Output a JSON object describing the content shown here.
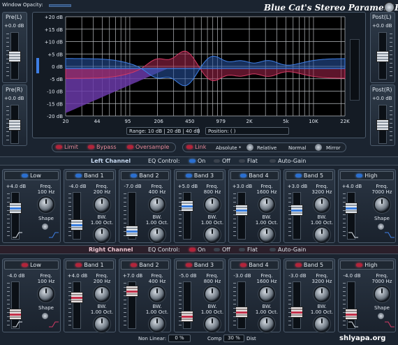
{
  "window_opacity_label": "Window Opacity:",
  "title": "Blue Cat's Stereo Parametr'EQ",
  "meters": {
    "pre_l": {
      "label": "Pre(L)",
      "value": "+0.0 dB"
    },
    "pre_r": {
      "label": "Pre(R)",
      "value": "+0.0 dB"
    },
    "post_l": {
      "label": "Post(L)",
      "value": "+0.0 dB"
    },
    "post_r": {
      "label": "Post(R)",
      "value": "+0.0 dB"
    }
  },
  "graph": {
    "db_labels": [
      "+20 dB",
      "+15 dB",
      "+10 dB",
      "+5 dB",
      "0 dB",
      "-5 dB",
      "-10 dB",
      "-15 dB",
      "-20 dB"
    ],
    "freq_labels": [
      "20",
      "44",
      "95",
      "206",
      "450",
      "979",
      "2K",
      "5k",
      "10K",
      "22K"
    ],
    "range_text": "Range:  10 dB  |  20 dB  |  40 dB",
    "position_text": "Position: (                    )"
  },
  "options": {
    "limit": "Limit",
    "bypass": "Bypass",
    "oversample": "Oversample",
    "link": "Link",
    "absolute": "Absolute *",
    "relative": "Relative",
    "normal": "Normal",
    "mirror": "Mirror"
  },
  "left": {
    "title": "Left Channel",
    "eq_control": "EQ Control:",
    "on": "On",
    "off": "Off",
    "flat": "Flat",
    "auto_gain": "Auto-Gain",
    "bands": [
      {
        "name": "Low",
        "gain": "+4.0 dB",
        "freq_label": "Freq.",
        "freq": "100 Hz",
        "shape_label": "Shape"
      },
      {
        "name": "Band 1",
        "gain": "-4.0 dB",
        "freq_label": "Freq.",
        "freq": "200 Hz",
        "bw_label": "BW.",
        "bw": "1.00 Oct."
      },
      {
        "name": "Band 2",
        "gain": "-7.0 dB",
        "freq_label": "Freq.",
        "freq": "400 Hz",
        "bw_label": "BW.",
        "bw": "1.00 Oct."
      },
      {
        "name": "Band 3",
        "gain": "+5.0 dB",
        "freq_label": "Freq.",
        "freq": "800 Hz",
        "bw_label": "BW.",
        "bw": "1.00 Oct."
      },
      {
        "name": "Band 4",
        "gain": "+3.0 dB",
        "freq_label": "Freq.",
        "freq": "1600 Hz",
        "bw_label": "BW.",
        "bw": "1.00 Oct."
      },
      {
        "name": "Band 5",
        "gain": "+3.0 dB",
        "freq_label": "Freq.",
        "freq": "3200 Hz",
        "bw_label": "BW.",
        "bw": "1.00 Oct."
      },
      {
        "name": "High",
        "gain": "+4.0 dB",
        "freq_label": "Freq.",
        "freq": "7000 Hz",
        "shape_label": "Shape"
      }
    ]
  },
  "right": {
    "title": "Right Channel",
    "eq_control": "EQ Control:",
    "on": "On",
    "off": "Off",
    "flat": "Flat",
    "auto_gain": "Auto-Gain",
    "bands": [
      {
        "name": "Low",
        "gain": "-4.0 dB",
        "freq_label": "Freq.",
        "freq": "100 Hz",
        "shape_label": "Shape"
      },
      {
        "name": "Band 1",
        "gain": "+4.0 dB",
        "freq_label": "Freq.",
        "freq": "200 Hz",
        "bw_label": "BW.",
        "bw": "1.00 Oct."
      },
      {
        "name": "Band 2",
        "gain": "+7.0 dB",
        "freq_label": "Freq.",
        "freq": "400 Hz",
        "bw_label": "BW.",
        "bw": "1.00 Oct."
      },
      {
        "name": "Band 3",
        "gain": "-5.0 dB",
        "freq_label": "Freq.",
        "freq": "800 Hz",
        "bw_label": "BW.",
        "bw": "1.00 Oct."
      },
      {
        "name": "Band 4",
        "gain": "-3.0 dB",
        "freq_label": "Freq.",
        "freq": "1600 Hz",
        "bw_label": "BW.",
        "bw": "1.00 Oct."
      },
      {
        "name": "Band 5",
        "gain": "-3.0 dB",
        "freq_label": "Freq.",
        "freq": "3200 Hz",
        "bw_label": "BW.",
        "bw": "1.00 Oct."
      },
      {
        "name": "High",
        "gain": "-4.0 dB",
        "freq_label": "Freq.",
        "freq": "7000 Hz",
        "shape_label": "Shape"
      }
    ]
  },
  "footer": {
    "nonlinear_label": "Non Linear:",
    "nonlinear_value": "0 %",
    "comp_label": "Comp",
    "comp_value": "30 %",
    "dist_label": "Dist"
  },
  "watermark": "shlyapa.org",
  "colors": {
    "left": "#2a6fd1",
    "right": "#b3243a",
    "curve_left": "#3e7fe6",
    "curve_right": "#d33a64",
    "fill": "#6a3aa8"
  }
}
